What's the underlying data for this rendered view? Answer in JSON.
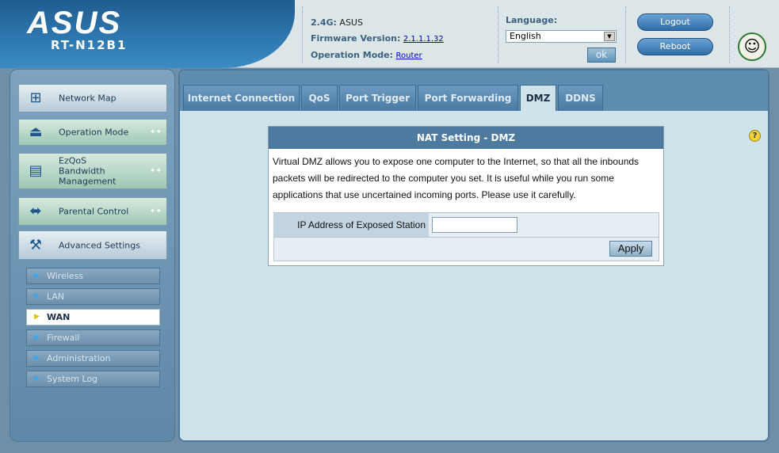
{
  "brand": {
    "logo": "ASUS",
    "model": "RT-N12B1"
  },
  "info": {
    "band_label": "2.4G:",
    "band_value": "ASUS",
    "firmware_label": "Firmware Version:",
    "firmware_value": "2.1.1.1.32",
    "mode_label": "Operation Mode:",
    "mode_value": "Router"
  },
  "language": {
    "label": "Language:",
    "selected": "English",
    "ok_label": "ok"
  },
  "header_buttons": {
    "logout": "Logout",
    "reboot": "Reboot"
  },
  "sidebar": {
    "items": [
      {
        "label": "Network Map",
        "icon": "network-map-icon"
      },
      {
        "label": "Operation Mode",
        "icon": "router-icon"
      },
      {
        "label": "EzQoS Bandwidth Management",
        "line1": "EzQoS",
        "line2": "Bandwidth",
        "line3": "Management",
        "icon": "bandwidth-icon"
      },
      {
        "label": "Parental Control",
        "icon": "parental-control-icon"
      },
      {
        "label": "Advanced Settings",
        "icon": "tools-icon"
      }
    ],
    "subitems": [
      "Wireless",
      "LAN",
      "WAN",
      "Firewall",
      "Administration",
      "System Log"
    ],
    "active_subitem": "WAN"
  },
  "tabs": [
    "Internet Connection",
    "QoS",
    "Port Trigger",
    "Port Forwarding",
    "DMZ",
    "DDNS"
  ],
  "active_tab": "DMZ",
  "panel": {
    "title": "NAT Setting - DMZ",
    "description": "Virtual DMZ allows you to expose one computer to the Internet, so that all the inbounds packets will be redirected to the computer you set. It is useful while you run some applications that use uncertained incoming ports. Please use it carefully.",
    "field_label": "IP Address of Exposed Station",
    "field_value": "",
    "apply_label": "Apply"
  },
  "colors": {
    "accent": "#4f7aa0",
    "header_bg": "#dce6e8",
    "panel_bg": "#cfe3ea"
  }
}
